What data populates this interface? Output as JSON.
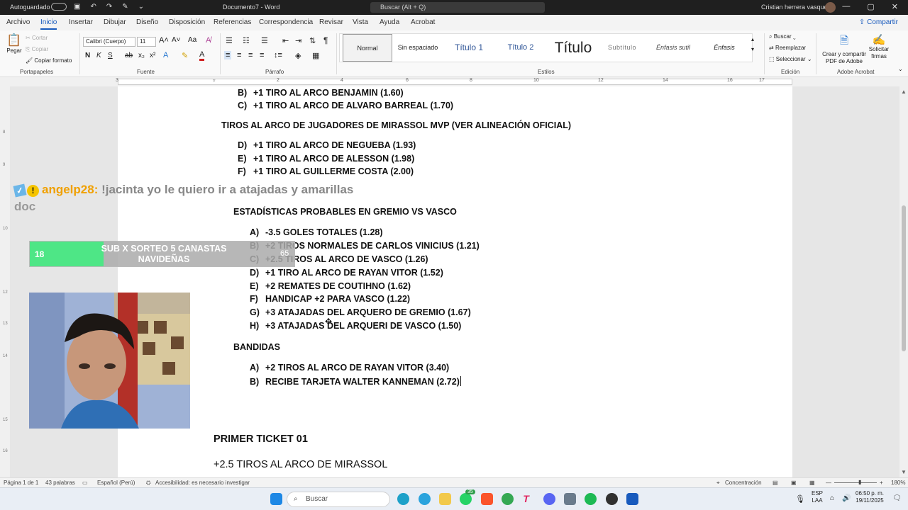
{
  "titlebar": {
    "autosave": "Autoguardado",
    "doc_title": "Documento7 - Word",
    "search_placeholder": "Buscar (Alt + Q)",
    "user_name": "Cristian herrera vasquez"
  },
  "tabs": [
    "Archivo",
    "Inicio",
    "Insertar",
    "Dibujar",
    "Diseño",
    "Disposición",
    "Referencias",
    "Correspondencia",
    "Revisar",
    "Vista",
    "Ayuda",
    "Acrobat"
  ],
  "active_tab": "Inicio",
  "share_label": "Compartir",
  "ribbon": {
    "paste": "Pegar",
    "cut": "Cortar",
    "copy": "Copiar",
    "format_painter": "Copiar formato",
    "clipboard_label": "Portapapeles",
    "font_name": "Calibri (Cuerpo)",
    "font_size": "11",
    "font_label": "Fuente",
    "paragraph_label": "Párrafo",
    "styles": [
      "Normal",
      "Sin espaciado",
      "Título 1",
      "Título 2",
      "Título",
      "Subtítulo",
      "Énfasis sutil",
      "Énfasis"
    ],
    "styles_label": "Estilos",
    "find": "Buscar",
    "replace": "Reemplazar",
    "select": "Seleccionar",
    "editing_label": "Edición",
    "acrobat_create": "Crear y compartir PDF de Adobe",
    "acrobat_sign": "Solicitar firmas",
    "acrobat_label": "Adobe Acrobat"
  },
  "document": {
    "block1": [
      {
        "marker": "B)",
        "text": "+1 TIRO AL ARCO BENJAMIN (1.60)"
      },
      {
        "marker": "C)",
        "text": "+1 TIRO AL ARCO DE ALVARO BARREAL (1.70)"
      }
    ],
    "heading_mirassol": "TIROS AL ARCO DE JUGADORES DE MIRASSOL MVP (VER ALINEACIÓN OFICIAL)",
    "block2": [
      {
        "marker": "D)",
        "text": "+1 TIRO AL ARCO DE NEGUEBA (1.93)"
      },
      {
        "marker": "E)",
        "text": "+1 TIRO AL ARCO DE ALESSON (1.98)"
      },
      {
        "marker": "F)",
        "text": "+1 TIRO AL GUILLERME COSTA (2.00)"
      }
    ],
    "heading_gremio": "ESTADÍSTICAS PROBABLES EN GREMIO VS VASCO",
    "block3": [
      {
        "marker": "A)",
        "text": "-3.5 GOLES TOTALES (1.28)"
      },
      {
        "marker": "B)",
        "text": "+2 TIROS NORMALES DE CARLOS VINICIUS (1.21)"
      },
      {
        "marker": "C)",
        "text": "+2.5 TIROS AL ARCO DE VASCO (1.26)"
      },
      {
        "marker": "D)",
        "text": "+1 TIRO AL ARCO DE RAYAN VITOR (1.52)"
      },
      {
        "marker": "E)",
        "text": "+2 REMATES DE COUTIHNO (1.62)"
      },
      {
        "marker": "F)",
        "text": "HANDICAP +2 PARA VASCO (1.22)"
      },
      {
        "marker": "G)",
        "text": "+3 ATAJADAS DEL ARQUERO DE GREMIO (1.67)"
      },
      {
        "marker": "H)",
        "text": "+3 ATAJADAS DEL ARQUERI DE VASCO (1.50)"
      }
    ],
    "heading_bandidas": "BANDIDAS",
    "block4": [
      {
        "marker": "A)",
        "text": "+2 TIROS AL ARCO DE RAYAN VITOR (3.40)"
      },
      {
        "marker": "B)",
        "text": "RECIBE TARJETA WALTER KANNEMAN (2.72)"
      }
    ],
    "ticket_heading": "PRIMER TICKET 01",
    "ticket_line": "+2.5 TIROS AL ARCO DE MIRASSOL"
  },
  "overlay": {
    "chat_user": "angelp28:",
    "chat_message": "!jacinta yo le quiero ir a atajadas y amarillas",
    "chat_message_cont": "doc",
    "goal_current": "18",
    "goal_title": "SUB X SORTEO 5 CANASTAS NAVIDEÑAS",
    "goal_target": "65",
    "goal_progress": 0.28
  },
  "statusbar": {
    "page": "Página 1 de 1",
    "words": "43 palabras",
    "language": "Español (Perú)",
    "accessibility": "Accesibilidad: es necesario investigar",
    "focus": "Concentración",
    "zoom": "180%"
  },
  "taskbar": {
    "search": "Buscar",
    "lang_top": "ESP",
    "lang_bottom": "LAA",
    "time": "06:50 p. m.",
    "date": "19/11/2025",
    "whatsapp_badge": "35"
  },
  "colors": {
    "accent": "#185abd",
    "goal_fill": "#4ee686",
    "chat_user": "#f0a000"
  }
}
